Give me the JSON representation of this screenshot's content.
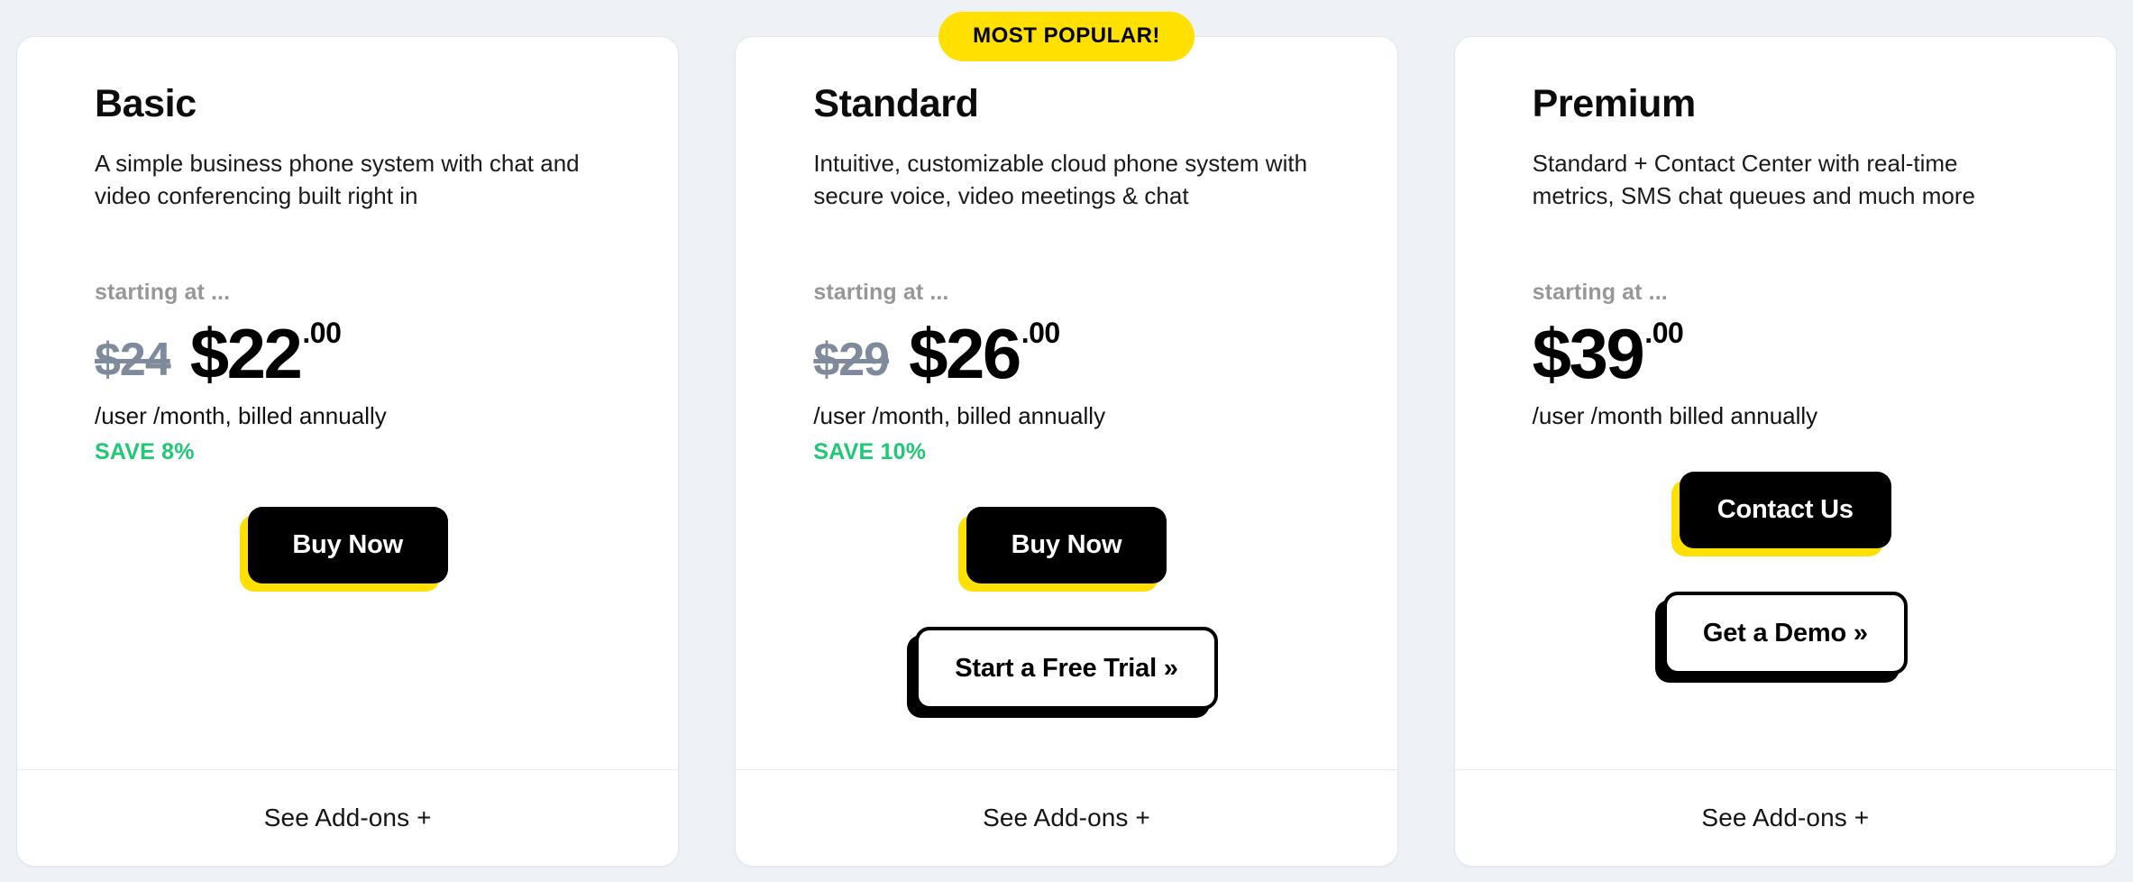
{
  "page": {
    "background_color": "#eef2f6",
    "accent_yellow": "#ffe000",
    "accent_green": "#1fc875",
    "muted_gray": "#979797",
    "strike_gray": "#7f8b9d"
  },
  "badge": {
    "label": "MOST POPULAR!",
    "on_plan": "Standard"
  },
  "plans": [
    {
      "id": "basic",
      "title": "Basic",
      "description": "A simple business phone system with chat and video conferencing built right in",
      "starting_at_label": "starting at ...",
      "price_old": "$24",
      "price_main": "$22",
      "price_cents": ".00",
      "billing_note": "/user /month, billed annually",
      "save_note": "SAVE 8%",
      "primary_cta": "Buy Now",
      "secondary_cta": "",
      "footer_label": "See Add-ons +"
    },
    {
      "id": "standard",
      "title": "Standard",
      "description": "Intuitive, customizable cloud phone system with secure voice, video meetings & chat",
      "starting_at_label": "starting at ...",
      "price_old": "$29",
      "price_main": "$26",
      "price_cents": ".00",
      "billing_note": "/user /month, billed annually",
      "save_note": "SAVE 10%",
      "primary_cta": "Buy Now",
      "secondary_cta": "Start a Free Trial »",
      "footer_label": "See Add-ons +"
    },
    {
      "id": "premium",
      "title": "Premium",
      "description": "Standard + Contact Center with real-time metrics, SMS chat queues and much more",
      "starting_at_label": "starting at ...",
      "price_old": "",
      "price_main": "$39",
      "price_cents": ".00",
      "billing_note": "/user /month billed annually",
      "save_note": "",
      "primary_cta": "Contact Us",
      "secondary_cta": "Get a Demo »",
      "footer_label": "See Add-ons +"
    }
  ]
}
